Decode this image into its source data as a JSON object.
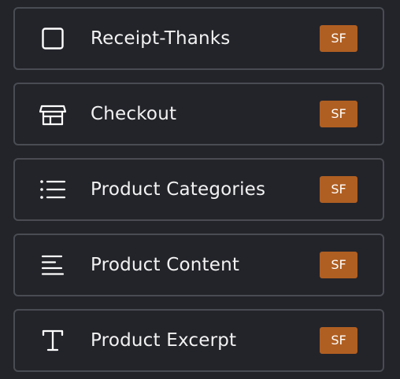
{
  "colors": {
    "background": "#23242a",
    "border": "#4a4c53",
    "text": "#f2f2f2",
    "badge": "#b05f22",
    "icon": "#ffffff"
  },
  "widgets": [
    {
      "label": "Receipt-Thanks",
      "badge": "SF",
      "icon": "square-icon"
    },
    {
      "label": "Checkout",
      "badge": "SF",
      "icon": "store-icon"
    },
    {
      "label": "Product Categories",
      "badge": "SF",
      "icon": "list-icon"
    },
    {
      "label": "Product Content",
      "badge": "SF",
      "icon": "text-align-left-icon"
    },
    {
      "label": "Product Excerpt",
      "badge": "SF",
      "icon": "text-t-icon"
    }
  ]
}
